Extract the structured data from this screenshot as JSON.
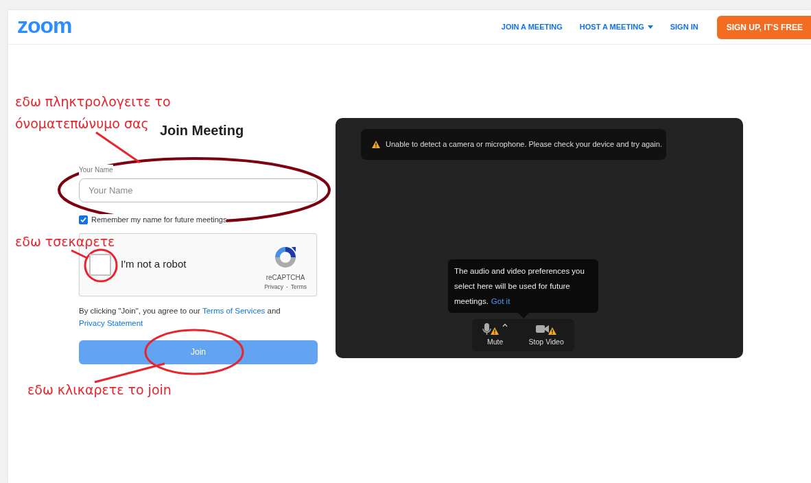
{
  "header": {
    "logo": "zoom",
    "nav": [
      {
        "label": "JOIN A MEETING",
        "dropdown": false
      },
      {
        "label": "HOST A MEETING",
        "dropdown": true
      },
      {
        "label": "SIGN IN",
        "dropdown": false
      }
    ],
    "signup": "SIGN UP, IT'S FREE"
  },
  "form": {
    "title": "Join Meeting",
    "name_label": "Your Name",
    "name_field": {
      "placeholder": "Your Name"
    },
    "remember": {
      "label": "Remember my name for future meetings",
      "checked": true
    },
    "captcha": {
      "label": "I'm not a robot",
      "checked": false,
      "brand": "reCAPTCHA",
      "privacy": "Privacy",
      "separator": "-",
      "terms": "Terms"
    },
    "agreement": {
      "prefix": "By clicking \"Join\", you agree to our",
      "link1": "Terms of Services",
      "middle": "and",
      "link2": "Privacy Statement"
    },
    "join_button": "Join"
  },
  "preview": {
    "warning": "Unable to detect a camera or microphone. Please check your device and try again.",
    "tooltip": {
      "text": "The audio and video preferences you select here will be used for future meetings.",
      "link": "Got it"
    },
    "controls": [
      {
        "kind": "mic",
        "label": "Mute",
        "warning": true,
        "menu": true
      },
      {
        "kind": "video",
        "label": "Stop Video",
        "warning": true,
        "menu": false
      }
    ]
  },
  "annotations": [
    {
      "text": "εδω πληκτρολογειτε το"
    },
    {
      "text": "όνοματεπώνυμο σας"
    },
    {
      "text": "εδω τσεκαρετε"
    },
    {
      "text": "εδω κλικαρετε το join"
    }
  ]
}
